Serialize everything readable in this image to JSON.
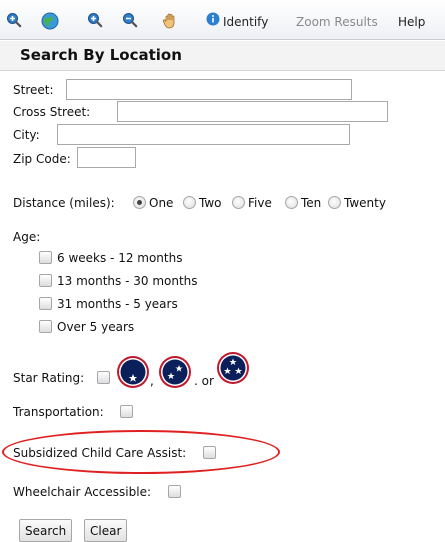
{
  "toolbar": {
    "identify_label": "Identify",
    "zoom_results_label": "Zoom Results",
    "help_label": "Help"
  },
  "section_title": "Search By Location",
  "address": {
    "street_label": "Street:",
    "cross_street_label": "Cross Street:",
    "city_label": "City:",
    "zip_label": "Zip Code:",
    "street_value": "",
    "cross_street_value": "",
    "city_value": "",
    "zip_value": ""
  },
  "distance": {
    "label": "Distance (miles):",
    "options": [
      "One",
      "Two",
      "Five",
      "Ten",
      "Twenty"
    ],
    "selected": "One"
  },
  "age": {
    "label": "Age:",
    "options": [
      "6 weeks - 12 months",
      "13 months - 30 months",
      "31 months - 5 years",
      "Over 5 years"
    ]
  },
  "star_rating": {
    "label": "Star Rating:",
    "sep_comma": ",",
    "sep_or": ". or"
  },
  "transportation_label": "Transportation:",
  "subsidized_label": "Subsidized Child Care Assist:",
  "wheelchair_label": "Wheelchair Accessible:",
  "buttons": {
    "search": "Search",
    "clear": "Clear"
  },
  "colors": {
    "star_badge_fill": "#0b1f5a",
    "star_badge_ring": "#c0182c",
    "highlight": "#e02020"
  }
}
